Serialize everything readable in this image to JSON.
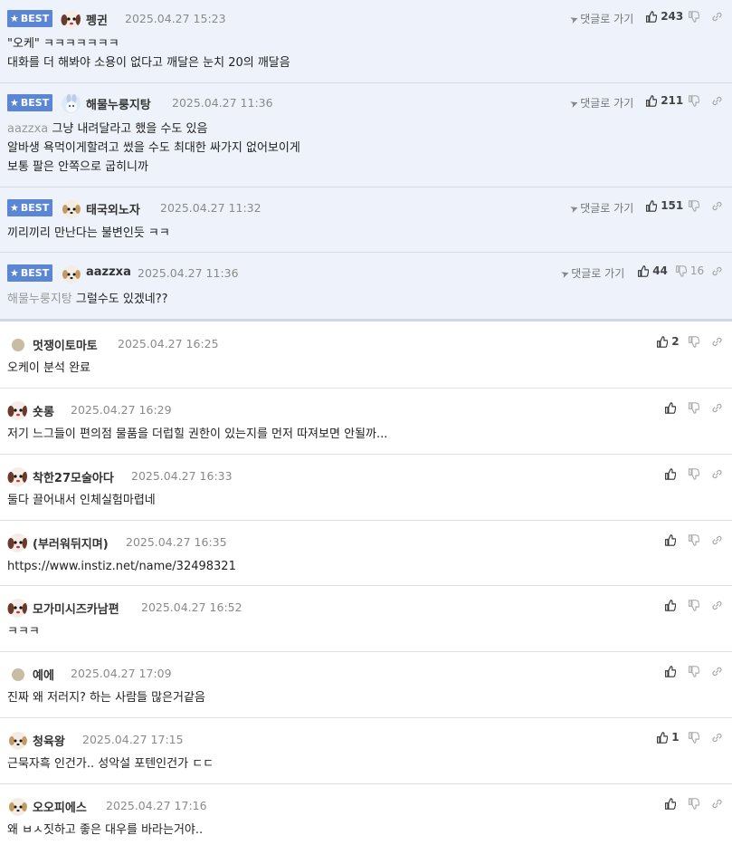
{
  "best_label": "BEST",
  "reply_label": "댓글로 가기",
  "comments": [
    {
      "nick": "펭귄",
      "date": "2025.04.27 15:23",
      "likes": "243",
      "dislikes": "",
      "mention": "",
      "lines": [
        "\"오케\" ㅋㅋㅋㅋㅋㅋㅋ",
        "대화를 더 해봐야 소용이 없다고 깨달은 눈치 20의 깨달음"
      ]
    },
    {
      "nick": "해물누룽지탕",
      "date": "2025.04.27 11:36",
      "likes": "211",
      "dislikes": "",
      "mention": "aazzxa",
      "lines": [
        "그냥 내려달라고 했을 수도 있음",
        "알바생 욕먹이게할려고 썼을 수도 최대한 싸가지 없어보이게",
        "보통 팔은 안쪽으로 굽히니까"
      ]
    },
    {
      "nick": "태국외노자",
      "date": "2025.04.27 11:32",
      "likes": "151",
      "dislikes": "",
      "mention": "",
      "lines": [
        "끼리끼리 만난다는 불변인듯 ㅋㅋ"
      ]
    },
    {
      "nick": "aazzxa",
      "date": "2025.04.27 11:36",
      "likes": "44",
      "dislikes": "16",
      "mention": "해물누룽지탕",
      "lines": [
        "그럴수도 있겠네??"
      ]
    },
    {
      "nick": "멋쟁이토마토",
      "date": "2025.04.27 16:25",
      "likes": "2",
      "dislikes": "",
      "mention": "",
      "lines": [
        "오케이 분석 완료"
      ]
    },
    {
      "nick": "숏롱",
      "date": "2025.04.27 16:29",
      "likes": "",
      "dislikes": "",
      "mention": "",
      "lines": [
        "저기 느그들이 편의점 물품을 더럽힐 권한이 있는지를 먼저 따져보면 안될까..."
      ]
    },
    {
      "nick": "착한27모술아다",
      "date": "2025.04.27 16:33",
      "likes": "",
      "dislikes": "",
      "mention": "",
      "lines": [
        "둘다 끌어내서 인체실험마렵네"
      ]
    },
    {
      "nick": "(부러워뒤지며)",
      "date": "2025.04.27 16:35",
      "likes": "",
      "dislikes": "",
      "mention": "",
      "lines": [
        "https://www.instiz.net/name/32498321"
      ]
    },
    {
      "nick": "모가미시즈카남편",
      "date": "2025.04.27 16:52",
      "likes": "",
      "dislikes": "",
      "mention": "",
      "lines": [
        "ㅋㅋㅋ"
      ]
    },
    {
      "nick": "예에",
      "date": "2025.04.27 17:09",
      "likes": "",
      "dislikes": "",
      "mention": "",
      "lines": [
        "진짜 왜 저러지? 하는 사람들 많은거같음"
      ]
    },
    {
      "nick": "청육왕",
      "date": "2025.04.27 17:15",
      "likes": "1",
      "dislikes": "",
      "mention": "",
      "lines": [
        "근묵자흑 인건가.. 성악설 포텐인건가 ㄷㄷ"
      ]
    },
    {
      "nick": "오오피에스",
      "date": "2025.04.27 17:16",
      "likes": "",
      "dislikes": "",
      "mention": "",
      "lines": [
        "왜 ㅂㅅ짓하고 좋은 대우를 바라는거야.."
      ]
    }
  ],
  "icons": {
    "star": "star-icon",
    "like": "thumb-up-icon",
    "dislike": "thumb-down-icon",
    "link": "link-icon",
    "reply": "send-arrow-icon",
    "avatar_dog": "dog-avatar-icon",
    "avatar_bunny": "bunny-avatar-icon",
    "avatar_dot": "dot-avatar-icon"
  },
  "colors": {
    "best_badge": "#5b86d6",
    "best_bg": "#eef2fa"
  }
}
